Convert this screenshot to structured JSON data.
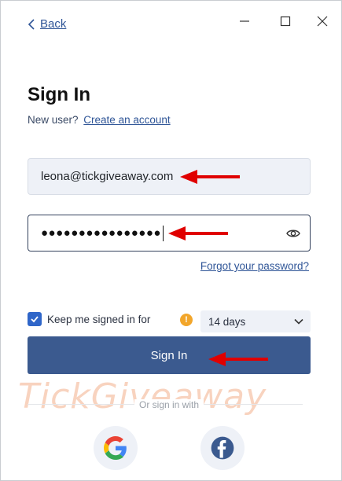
{
  "nav": {
    "back_label": "Back"
  },
  "window_controls": {
    "minimize": "minimize-icon",
    "maximize": "maximize-icon",
    "close": "close-icon"
  },
  "form": {
    "title": "Sign In",
    "new_user_prompt": "New user?",
    "create_account_label": "Create an account",
    "email_value": "leona@tickgiveaway.com",
    "password_masked": "●●●●●●●●●●●●●●●●",
    "forgot_password_label": "Forgot your password?",
    "keep_signed_in_label": "Keep me signed in for",
    "keep_signed_in_checked": true,
    "duration_selected": "14 days",
    "submit_label": "Sign In"
  },
  "social": {
    "divider_label": "Or sign in with",
    "providers": [
      "google",
      "facebook"
    ]
  },
  "watermark": "TickGiveaway",
  "colors": {
    "accent": "#3b5a8f",
    "link": "#2f5597",
    "arrow": "#e00000",
    "warning": "#f2a62b"
  }
}
